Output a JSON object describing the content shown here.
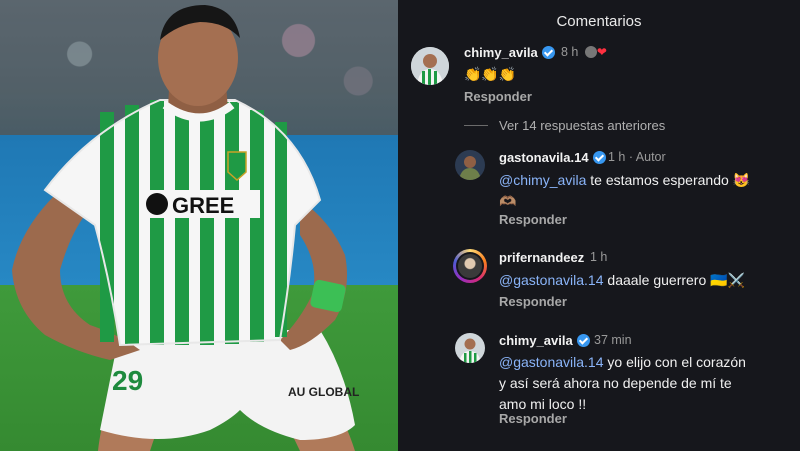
{
  "header": {
    "title": "Comentarios"
  },
  "jersey_brand": "GREE",
  "kit_maker_sponsor": "AU GLOBAL",
  "comments": [
    {
      "username": "chimy_avila",
      "verified": true,
      "time": "8 h",
      "time_suffix_icon": "avatar-heart",
      "text": "👏👏👏",
      "reply_label": "Responder"
    }
  ],
  "view_more": "Ver 14 respuestas anteriores",
  "replies": [
    {
      "username": "gastonavila.14",
      "verified": true,
      "time": "1 h · Autor",
      "mention": "@chimy_avila",
      "text": " te estamos esperando 😻",
      "text_line2": "🫶🏽",
      "reply_label": "Responder"
    },
    {
      "username": "prifernandeez",
      "verified": false,
      "time": "1 h",
      "mention": "@gastonavila.14",
      "text": " daaale guerrero 🇺🇦⚔️",
      "reply_label": "Responder"
    },
    {
      "username": "chimy_avila",
      "verified": true,
      "time": "37 min",
      "mention": "@gastonavila.14",
      "text": " yo elijo con el corazón",
      "text_line2": "y así será ahora no depende de mí te",
      "text_line3": "amo mi loco !!",
      "reply_label": "Responder"
    }
  ],
  "colors": {
    "panel_bg": "#16171c",
    "mention": "#8ab4f8",
    "verified": "#3797f0"
  }
}
